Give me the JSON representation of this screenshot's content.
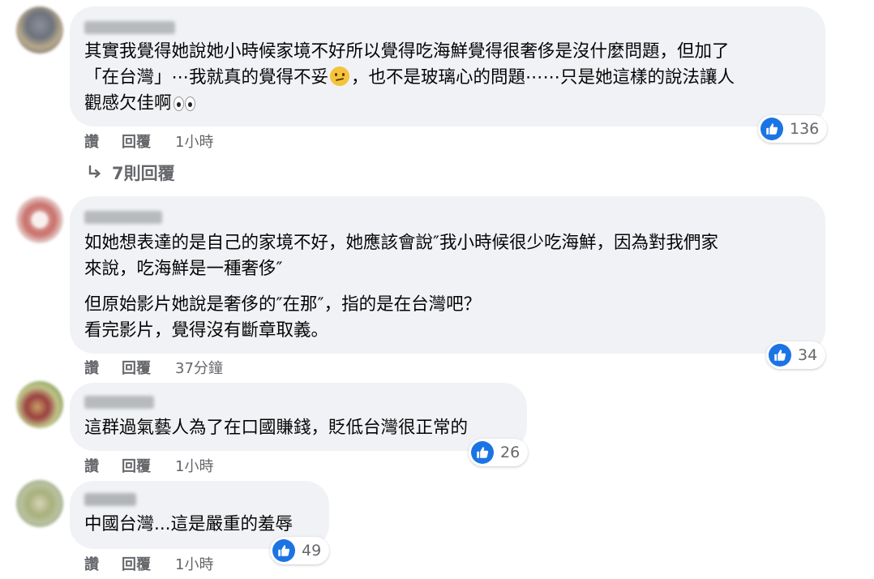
{
  "colors": {
    "bubble": "#f0f2f5",
    "like_blue": "#1b74e4",
    "meta_gray": "#65676b",
    "text": "#050505"
  },
  "comments": [
    {
      "lines": [
        "其實我覺得她說她小時候家境不好所以覺得吃海鮮覺得很奢侈是沒什麼問題，但加了",
        "「在台灣」⋯我就真的覺得不妥",
        "，也不是玻璃心的問題⋯⋯只是她這樣的說法讓人",
        "觀感欠佳啊"
      ],
      "reactions": "136",
      "like": "讚",
      "reply": "回覆",
      "time": "1小時",
      "replies_label": "7則回覆"
    },
    {
      "lines": [
        "如她想表達的是自己的家境不好，她應該會說″我小時候很少吃海鮮，因為對我們家",
        "來說，吃海鮮是一種奢侈″",
        "但原始影片她說是奢侈的″在那″，指的是在台灣吧？",
        "看完影片，覺得沒有斷章取義。"
      ],
      "reactions": "34",
      "like": "讚",
      "reply": "回覆",
      "time": "37分鐘"
    },
    {
      "lines": [
        "這群過氣藝人為了在口國賺錢，貶低台灣很正常的"
      ],
      "reactions": "26",
      "like": "讚",
      "reply": "回覆",
      "time": "1小時"
    },
    {
      "lines": [
        "中國台灣...這是嚴重的羞辱"
      ],
      "reactions": "49",
      "like": "讚",
      "reply": "回覆",
      "time": "1小時"
    }
  ]
}
